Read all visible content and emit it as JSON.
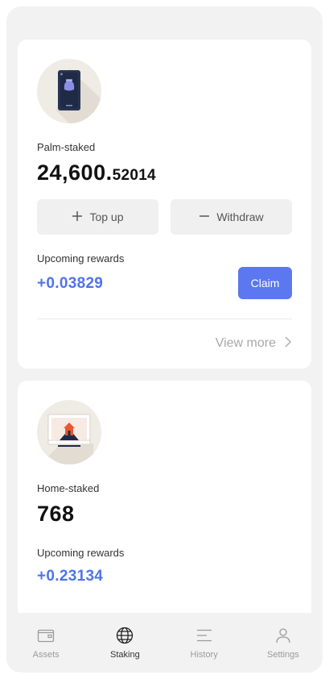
{
  "palm_card": {
    "icon": "palm-scanner-icon",
    "label": "Palm-staked",
    "amount_int": "24,600.",
    "amount_frac": "52014",
    "topup_label": "Top up",
    "withdraw_label": "Withdraw",
    "rewards_label": "Upcoming rewards",
    "rewards_value": "+0.03829",
    "claim_label": "Claim",
    "view_more_label": "View more"
  },
  "home_card": {
    "icon": "home-monitor-icon",
    "label": "Home-staked",
    "amount": "768",
    "rewards_label": "Upcoming rewards",
    "rewards_value": "+0.23134"
  },
  "tabs": [
    {
      "label": "Assets",
      "icon": "wallet-icon",
      "active": false
    },
    {
      "label": "Staking",
      "icon": "globe-icon",
      "active": true
    },
    {
      "label": "History",
      "icon": "history-lines-icon",
      "active": false
    },
    {
      "label": "Settings",
      "icon": "person-icon",
      "active": false
    }
  ],
  "colors": {
    "accent": "#5b78f0",
    "reward": "#4f74ea",
    "background": "#f2f2f2"
  }
}
